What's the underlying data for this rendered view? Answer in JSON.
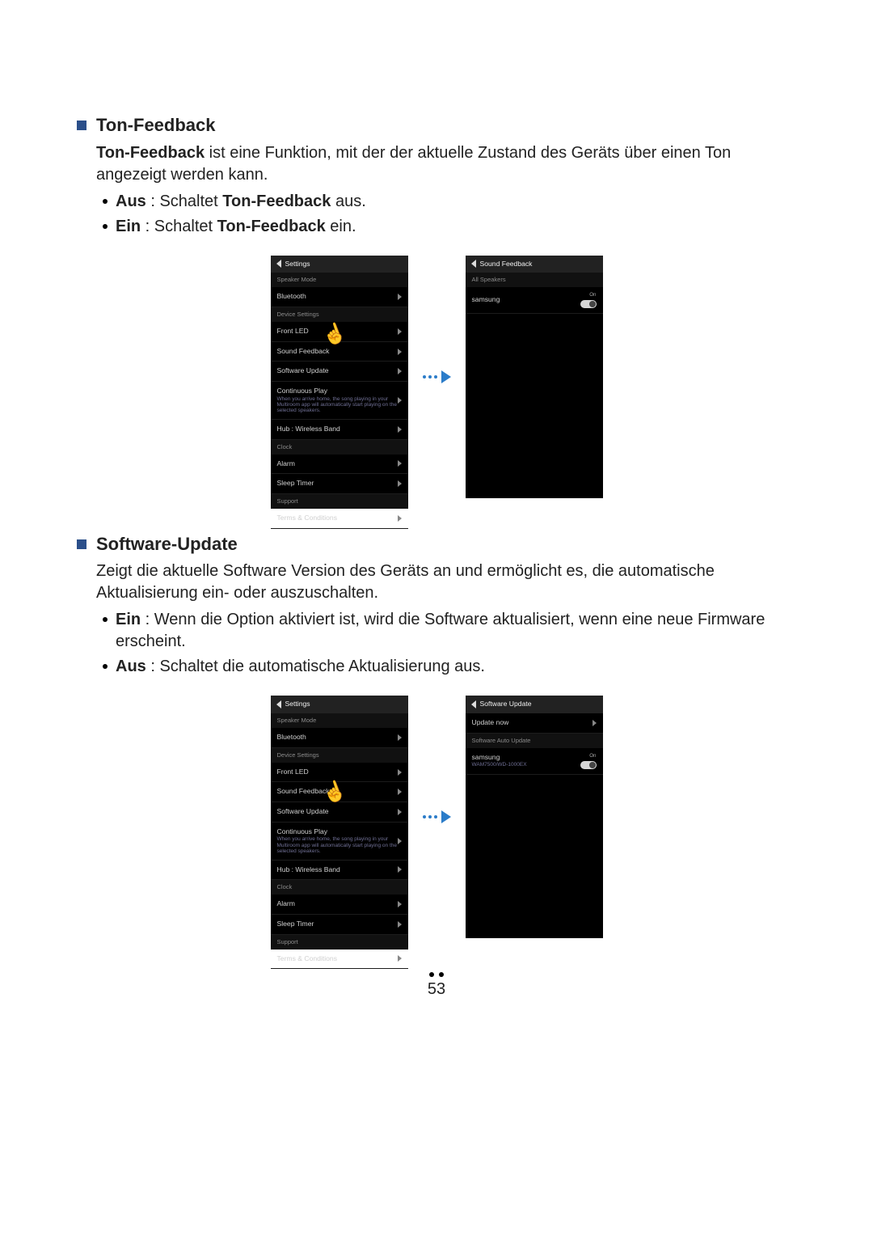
{
  "page_number": "53",
  "section1": {
    "title": "Ton-Feedback",
    "desc_bold": "Ton-Feedback",
    "desc_rest": " ist eine Funktion, mit der der aktuelle Zustand des Geräts über einen Ton angezeigt werden kann.",
    "bullets": [
      {
        "bold": "Aus",
        "sep": " : Schaltet ",
        "bold2": "Ton-Feedback",
        "rest": " aus."
      },
      {
        "bold": "Ein",
        "sep": " : Schaltet ",
        "bold2": "Ton-Feedback",
        "rest": " ein."
      }
    ]
  },
  "section2": {
    "title": "Software-Update",
    "desc": "Zeigt die aktuelle Software Version des Geräts an und ermöglicht es, die automatische Aktualisierung ein- oder auszuschalten.",
    "bullets": [
      {
        "bold": "Ein",
        "rest": " : Wenn die Option aktiviert ist, wird die Software aktualisiert, wenn eine neue Firmware erscheint."
      },
      {
        "bold": "Aus",
        "rest": " : Schaltet die automatische Aktualisierung aus."
      }
    ]
  },
  "settings_screen": {
    "title": "Settings",
    "groups": {
      "speaker_mode": "Speaker Mode",
      "device_settings": "Device Settings",
      "clock": "Clock",
      "support": "Support"
    },
    "items": {
      "bluetooth": "Bluetooth",
      "front_led": "Front LED",
      "sound_feedback": "Sound Feedback",
      "software_update": "Software Update",
      "continuous": "Continuous Play",
      "continuous_sub": "When you arrive home, the song playing in your Multiroom app will automatically start playing on the selected speakers.",
      "hub": "Hub : Wireless Band",
      "alarm": "Alarm",
      "sleep": "Sleep Timer",
      "terms": "Terms & Conditions"
    }
  },
  "sound_feedback_screen": {
    "title": "Sound Feedback",
    "section": "All Speakers",
    "item": "samsung",
    "toggle_label": "On"
  },
  "software_update_screen": {
    "title": "Software Update",
    "update_now": "Update now",
    "auto_section": "Software Auto Update",
    "item": "samsung",
    "item_sub": "WAM7500/WD-1000EX",
    "toggle_label": "On"
  }
}
